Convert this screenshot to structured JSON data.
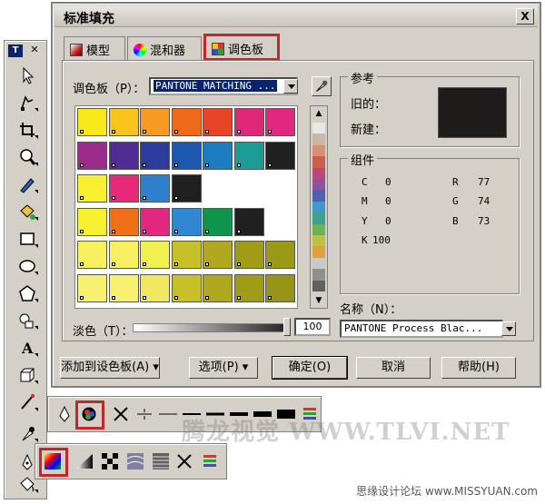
{
  "dialog": {
    "title": "标准填充",
    "close_label": "X"
  },
  "tabs": [
    {
      "label": "模型"
    },
    {
      "label": "混和器"
    },
    {
      "label": "调色板"
    }
  ],
  "palette": {
    "label": "调色板（P）：",
    "selected_value": "PANTONE MATCHING ..."
  },
  "swatch_colors": [
    [
      "#f8e81c",
      "#f8c41c",
      "#f89a24",
      "#f06a1c",
      "#e84428",
      "#e02878",
      "#e02880"
    ],
    [
      "#9c2c8c",
      "#502c94",
      "#2c3c9c",
      "#1c58b0",
      "#1c7cc0",
      "#1c9c94",
      "#202020"
    ],
    [
      "#f8f030",
      "#e82878",
      "#3080d0",
      "#202020",
      "#ffffff",
      "#ffffff",
      "#ffffff"
    ],
    [
      "#f8f030",
      "#f07018",
      "#e02880",
      "#3088d0",
      "#10944c",
      "#202020",
      "#ffffff"
    ],
    [
      "#f8f060",
      "#f8f060",
      "#f0f050",
      "#c8c028",
      "#b0a820",
      "#a09c18",
      "#9c9818"
    ],
    [
      "#f8f070",
      "#f8f070",
      "#f0e860",
      "#c8c028",
      "#b0a820",
      "#a09c18",
      "#989418"
    ]
  ],
  "strip_colors": [
    "#e8e8e8",
    "#c8b8a8",
    "#d89070",
    "#c86050",
    "#b84878",
    "#9050a0",
    "#5060b0",
    "#4098c8",
    "#40a090",
    "#70b050",
    "#c0c040",
    "#e0a040",
    "#c8c8c8",
    "#909090",
    "#606060"
  ],
  "tint": {
    "label": "淡色（T）：",
    "value": "100"
  },
  "reference": {
    "title": "参考",
    "old_label": "旧的：",
    "new_label": "新建：",
    "color": "#1e1c1a"
  },
  "components": {
    "title": "组件",
    "cmyk": [
      {
        "k": "C",
        "v": "0"
      },
      {
        "k": "M",
        "v": "0"
      },
      {
        "k": "Y",
        "v": "0"
      },
      {
        "k": "K",
        "v": "100"
      }
    ],
    "rgb": [
      {
        "k": "R",
        "v": "77"
      },
      {
        "k": "G",
        "v": "74"
      },
      {
        "k": "B",
        "v": "73"
      }
    ]
  },
  "name_field": {
    "label": "名称（N）：",
    "value": "PANTONE Process Blac..."
  },
  "buttons": {
    "add_to_palette": "添加到设色板(A)",
    "options": "选项(P)",
    "ok": "确定(O)",
    "cancel": "取消",
    "help": "帮助(H)"
  },
  "watermark": "腾龙视觉 WWW.TLVI.NET",
  "footer": "思缘设计论坛 www.MISSYUAN.com",
  "toolbox_caption": "T"
}
